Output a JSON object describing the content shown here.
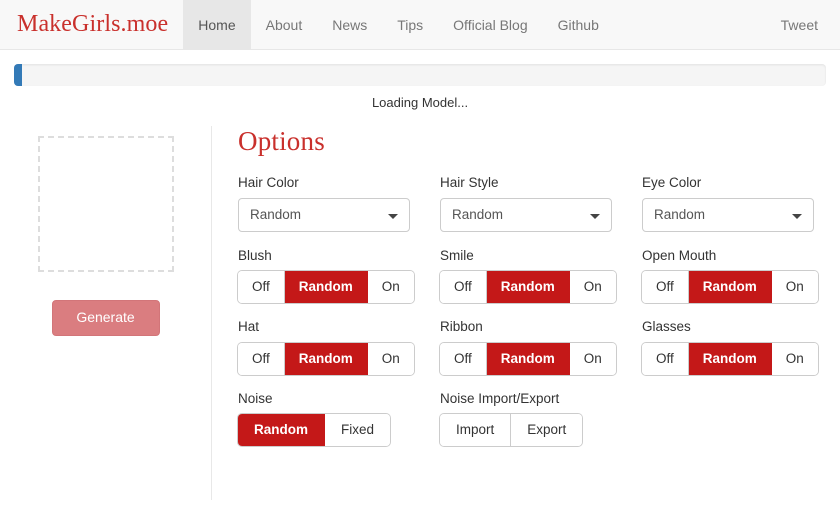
{
  "navbar": {
    "brand": "MakeGirls.moe",
    "items": [
      {
        "label": "Home",
        "active": true
      },
      {
        "label": "About",
        "active": false
      },
      {
        "label": "News",
        "active": false
      },
      {
        "label": "Tips",
        "active": false
      },
      {
        "label": "Official Blog",
        "active": false
      },
      {
        "label": "Github",
        "active": false
      }
    ],
    "tweet_label": "Tweet"
  },
  "progress": {
    "percent": 1,
    "status_text": "Loading Model...",
    "bar_color": "#337ab7",
    "track_color": "#f5f5f5"
  },
  "preview": {
    "generate_label": "Generate"
  },
  "options": {
    "title": "Options",
    "accent_color": "#c9302c",
    "active_button_color": "#c41818",
    "cells": [
      {
        "label": "Hair Color",
        "type": "select",
        "value": "Random"
      },
      {
        "label": "Hair Style",
        "type": "select",
        "value": "Random"
      },
      {
        "label": "Eye Color",
        "type": "select",
        "value": "Random"
      },
      {
        "label": "Blush",
        "type": "buttons",
        "buttons": [
          "Off",
          "Random",
          "On"
        ],
        "active": 1
      },
      {
        "label": "Smile",
        "type": "buttons",
        "buttons": [
          "Off",
          "Random",
          "On"
        ],
        "active": 1
      },
      {
        "label": "Open Mouth",
        "type": "buttons",
        "buttons": [
          "Off",
          "Random",
          "On"
        ],
        "active": 1
      },
      {
        "label": "Hat",
        "type": "buttons",
        "buttons": [
          "Off",
          "Random",
          "On"
        ],
        "active": 1
      },
      {
        "label": "Ribbon",
        "type": "buttons",
        "buttons": [
          "Off",
          "Random",
          "On"
        ],
        "active": 1
      },
      {
        "label": "Glasses",
        "type": "buttons",
        "buttons": [
          "Off",
          "Random",
          "On"
        ],
        "active": 1
      },
      {
        "label": "Noise",
        "type": "buttons",
        "buttons": [
          "Random",
          "Fixed"
        ],
        "active": 0
      },
      {
        "label": "Noise Import/Export",
        "type": "buttons",
        "buttons": [
          "Import",
          "Export"
        ],
        "active": -1
      },
      {
        "label": "",
        "type": "empty"
      }
    ]
  }
}
